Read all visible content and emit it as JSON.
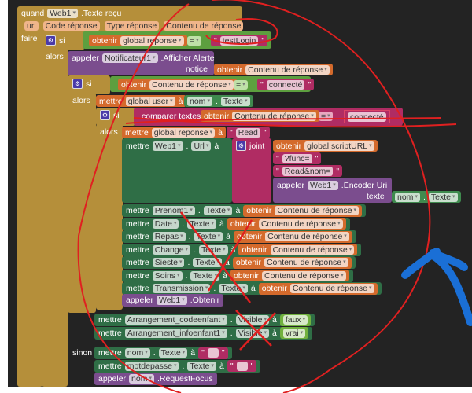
{
  "event": {
    "quand": "quand",
    "component": "Web1",
    "name": ".Texte reçu",
    "params": [
      "url",
      "Code réponse",
      "Type réponse",
      "Contenu de réponse"
    ],
    "faire": "faire"
  },
  "kw": {
    "si": "si",
    "alors": "alors",
    "sinon": "sinon",
    "obtenir": "obtenir",
    "mettre": "mettre",
    "a": "à",
    "appeler": "appeler",
    "eq": "=",
    "dot": ".",
    "joint": "joint",
    "notice": "notice",
    "texte": "texte",
    "compare": "comparer textes"
  },
  "if1": {
    "var": "global reponse",
    "str": "testLogin"
  },
  "alert": {
    "component": "Notificateur1",
    "method": ".Afficher Alerte",
    "value": "Contenu de réponse"
  },
  "if2": {
    "var": "Contenu de réponse",
    "str": "connecté"
  },
  "setuser": {
    "var": "global user",
    "comp": "nom",
    "prop": "Texte"
  },
  "if3": {
    "var": "Contenu de réponse",
    "str": "connecté"
  },
  "setresp": {
    "var": "global reponse",
    "str": "Read"
  },
  "seturl": {
    "comp": "Web1",
    "prop": "Url",
    "scripturl": "global scriptURL",
    "s1": "?func=",
    "s2": "Read&nom=",
    "enc_comp": "Web1",
    "enc_method": ".Encoder Uri",
    "nom": "nom",
    "nomprop": "Texte"
  },
  "sets": [
    {
      "comp": "Prenom1",
      "prop": "Texte",
      "val": "Contenu de réponse"
    },
    {
      "comp": "Date",
      "prop": "Texte",
      "val": "Contenu de réponse"
    },
    {
      "comp": "Repas",
      "prop": "Texte",
      "val": "Contenu de réponse"
    },
    {
      "comp": "Change",
      "prop": "Texte",
      "val": "Contenu de réponse"
    },
    {
      "comp": "Sieste",
      "prop": "Texte",
      "val": "Contenu de réponse"
    },
    {
      "comp": "Soins",
      "prop": "Texte",
      "val": "Contenu de réponse"
    },
    {
      "comp": "Transmission",
      "prop": "Texte",
      "val": "Contenu de réponse"
    }
  ],
  "obtenir": {
    "comp": "Web1",
    "method": ".Obtenir"
  },
  "vis": [
    {
      "comp": "Arrangement_codeenfant",
      "prop": "Visible",
      "val": "faux"
    },
    {
      "comp": "Arrangement_infoenfant1",
      "prop": "Visible",
      "val": "vrai"
    }
  ],
  "else": [
    {
      "comp": "nom",
      "prop": "Texte"
    },
    {
      "comp": "motdepasse",
      "prop": "Texte"
    }
  ],
  "focus": {
    "comp": "nom",
    "method": ".RequestFocus"
  },
  "colors": {
    "event": "#b58f3a",
    "annotation_red": "#e02020",
    "annotation_blue": "#1a6fd6"
  }
}
